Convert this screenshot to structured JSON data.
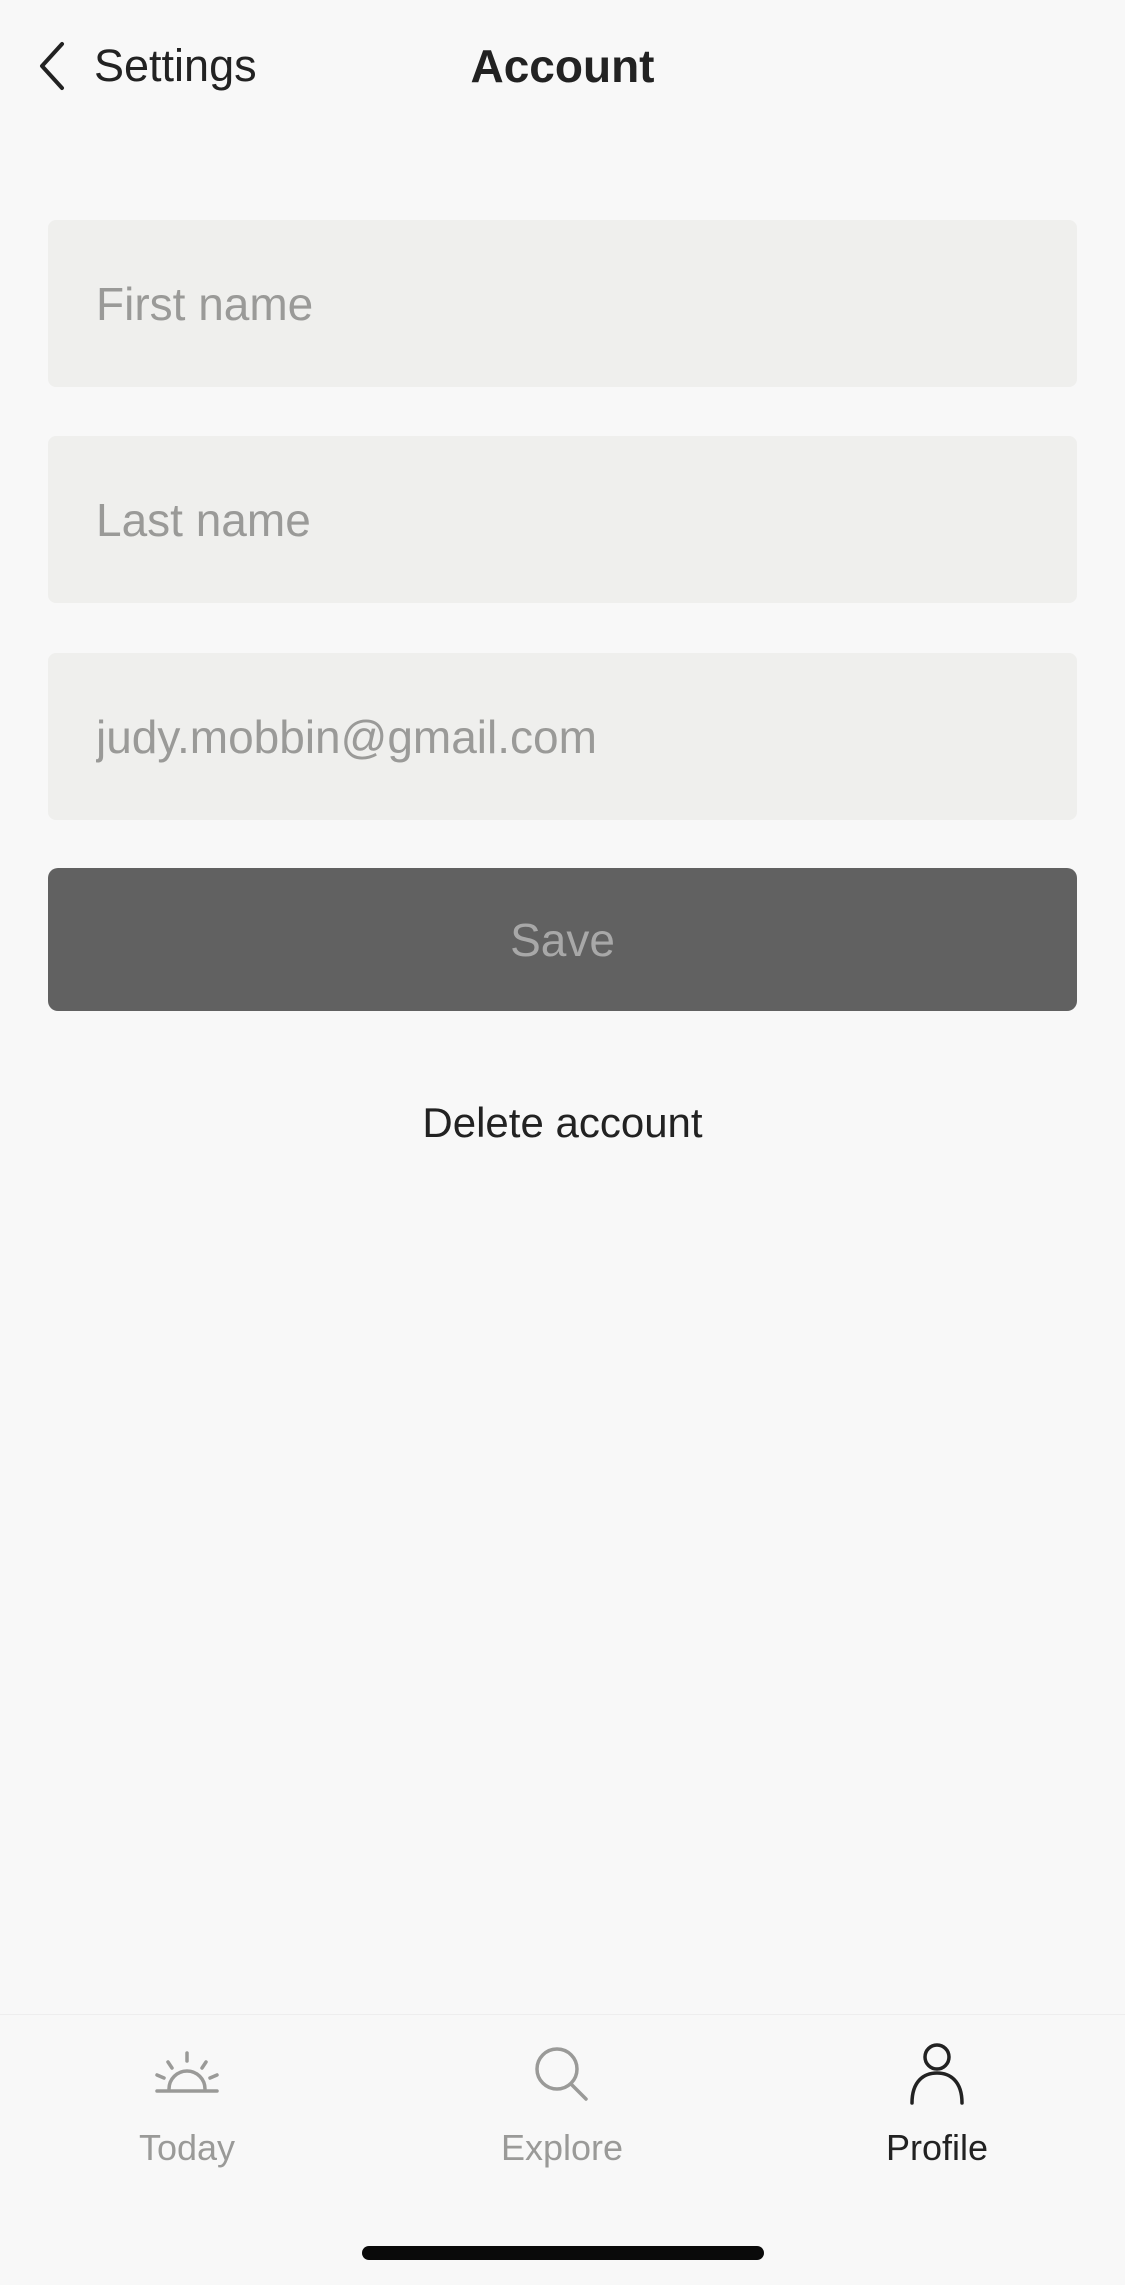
{
  "header": {
    "back_label": "Settings",
    "title": "Account"
  },
  "form": {
    "first_name": {
      "value": "",
      "placeholder": "First name"
    },
    "last_name": {
      "value": "",
      "placeholder": "Last name"
    },
    "email": {
      "value": "judy.mobbin@gmail.com",
      "placeholder": ""
    },
    "save_label": "Save",
    "delete_label": "Delete account"
  },
  "tabbar": {
    "tabs": [
      {
        "label": "Today",
        "icon": "sunrise-icon",
        "active": false
      },
      {
        "label": "Explore",
        "icon": "search-icon",
        "active": false
      },
      {
        "label": "Profile",
        "icon": "person-icon",
        "active": true
      }
    ]
  },
  "colors": {
    "background": "#f8f8f8",
    "field_background": "#efefed",
    "save_button": "#616161",
    "text_primary": "#222222",
    "text_muted": "#9a9a98"
  }
}
